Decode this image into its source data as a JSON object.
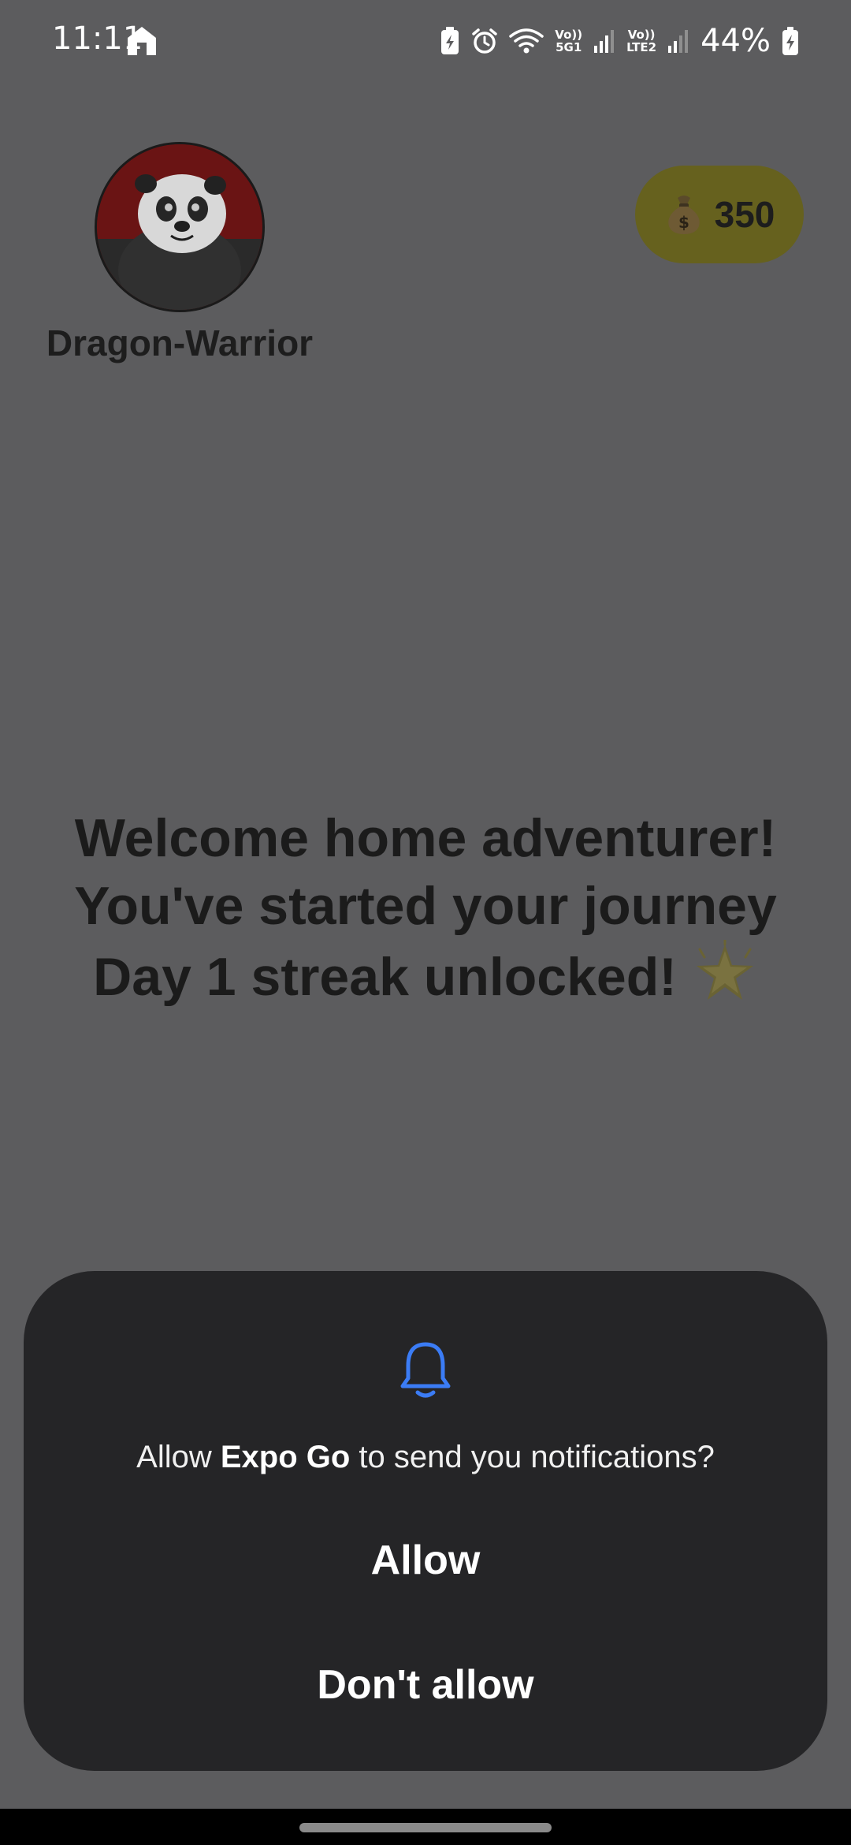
{
  "status_bar": {
    "time": "11:11",
    "sim1_label_top": "Vo))",
    "sim1_label_bottom": "5G1",
    "sim2_label_top": "Vo))",
    "sim2_label_bottom": "LTE2",
    "battery_percent": "44%"
  },
  "profile": {
    "username": "Dragon-Warrior",
    "coins": "350",
    "coin_icon": "money-bag-icon",
    "avatar": "panda-avatar"
  },
  "welcome": {
    "line1": "Welcome home adventurer!",
    "line2": "You've started your journey",
    "line3": "Day 1 streak unlocked!",
    "line3_icon": "sparkle-star-icon"
  },
  "permission_dialog": {
    "icon": "bell-icon",
    "message_prefix": "Allow ",
    "app_name": "Expo Go",
    "message_suffix": " to send you notifications?",
    "allow_label": "Allow",
    "deny_label": "Don't allow"
  },
  "colors": {
    "accent_blue": "#3b7cf5",
    "dialog_bg": "#252527",
    "coin_badge_bg": "#66611e",
    "scrim_bg": "#5c5c5e"
  }
}
